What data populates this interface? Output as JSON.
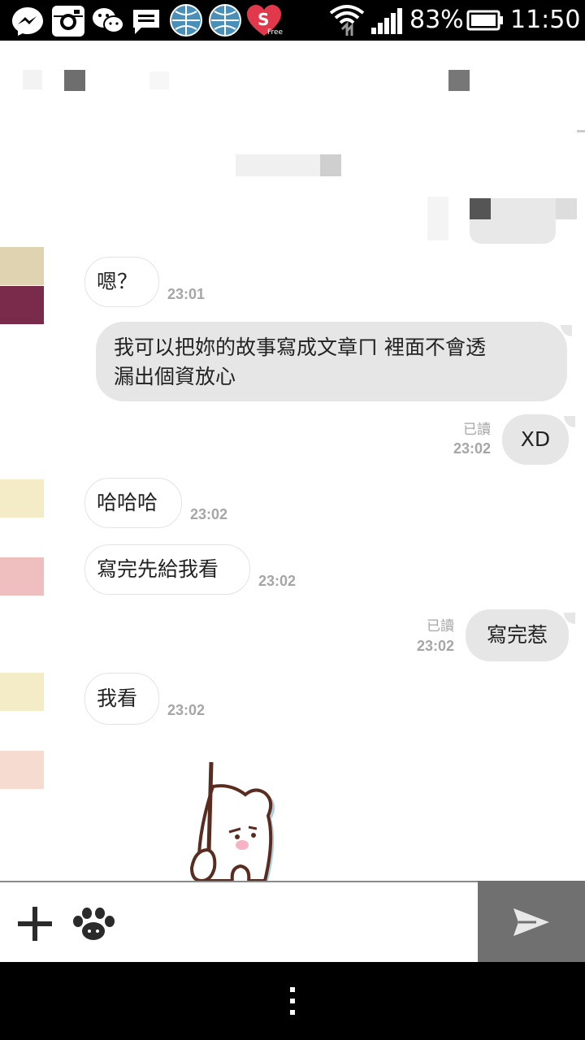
{
  "status_bar": {
    "battery": "83%",
    "time": "11:50",
    "app_icons": [
      "messenger-icon",
      "instagram-icon",
      "wechat-icon",
      "message-icon",
      "globe-icon",
      "globe-icon",
      "heart-free-icon"
    ],
    "heart_badge": "Free"
  },
  "messages": [
    {
      "side": "in",
      "text": "嗯？",
      "time": "23:01"
    },
    {
      "side": "in",
      "text_line1": "我可以把妳的故事寫成文章ㄇ 裡面不會透",
      "text_line2": "漏出個資放心"
    },
    {
      "side": "out",
      "text": "XD",
      "read": "已讀",
      "time": "23:02"
    },
    {
      "side": "in",
      "text": "哈哈哈",
      "time": "23:02"
    },
    {
      "side": "in",
      "text": "寫完先給我看",
      "time": "23:02"
    },
    {
      "side": "out",
      "text": "寫完惹",
      "read": "已讀",
      "time": "23:02"
    },
    {
      "side": "in",
      "text": "我看",
      "time": "23:02"
    }
  ],
  "input_bar": {
    "icons": [
      "plus-icon",
      "paw-icon"
    ]
  },
  "send_icon": "send-icon",
  "nav_icon": "menu-dots-icon"
}
